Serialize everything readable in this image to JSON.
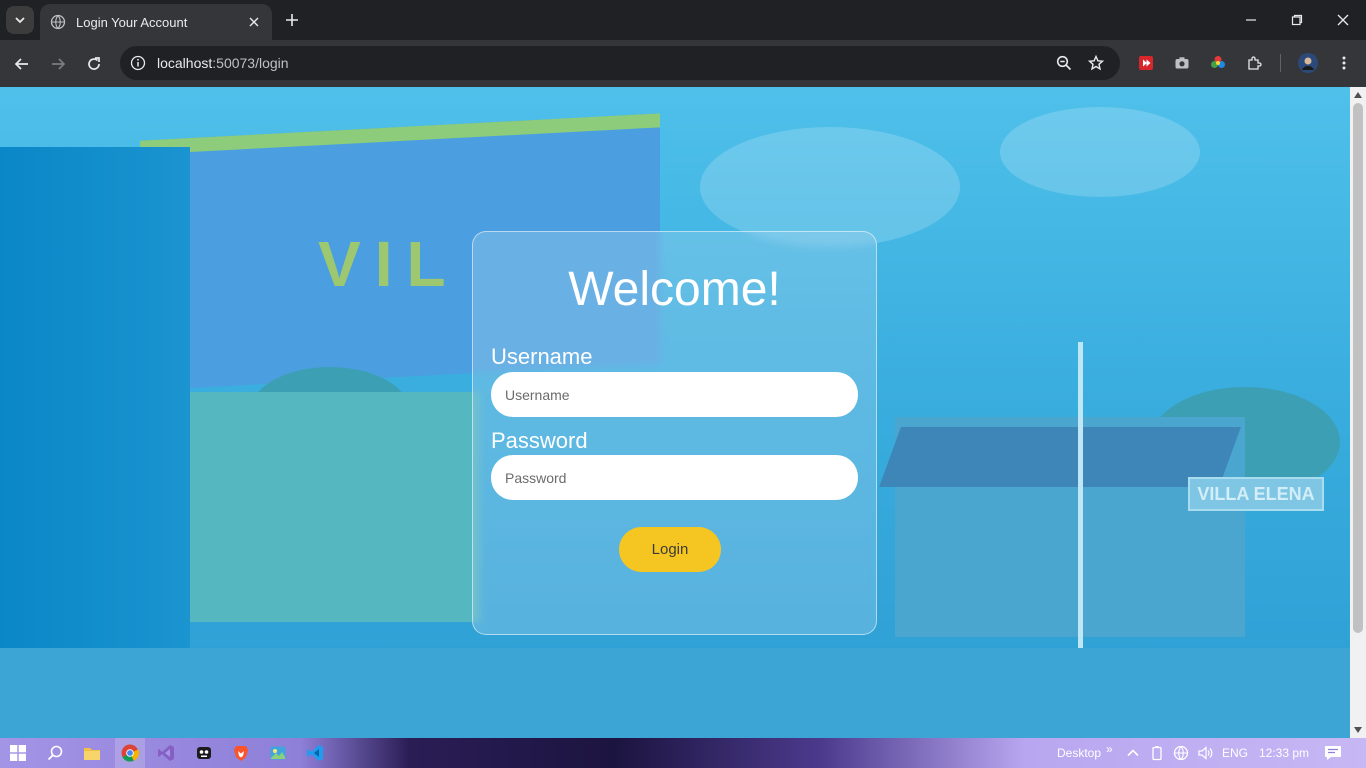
{
  "browser": {
    "tab": {
      "title": "Login Your Account"
    },
    "address_bar": {
      "url_host": "localhost",
      "url_rest": ":50073/login"
    }
  },
  "page": {
    "heading": "Welcome!",
    "username": {
      "label": "Username",
      "placeholder": "Username",
      "value": ""
    },
    "password": {
      "label": "Password",
      "placeholder": "Password",
      "value": ""
    },
    "login_button": "Login",
    "background_sign_text": "VILLA ELENA",
    "arch_text": "VIL"
  },
  "taskbar": {
    "desktop_label": "Desktop",
    "more_label": "»",
    "language": "ENG",
    "time": "12:33 pm"
  },
  "colors": {
    "accent_button": "#f5c621",
    "overlay": "#3aaedf",
    "chrome_dark": "#202124"
  }
}
